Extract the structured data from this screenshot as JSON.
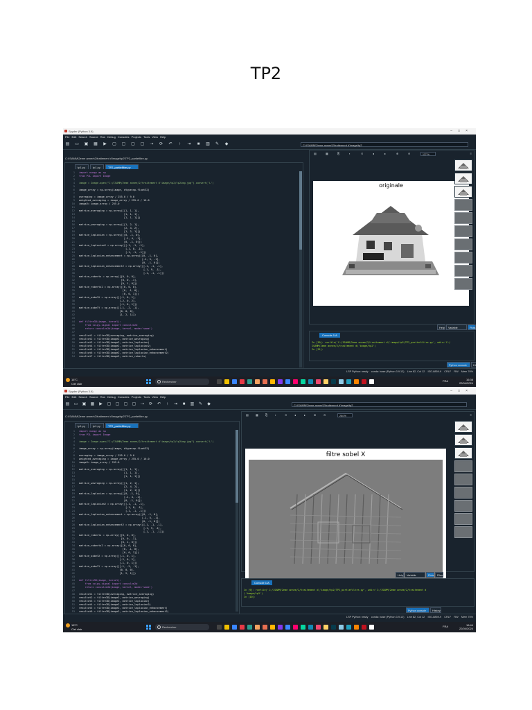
{
  "document": {
    "title": "TP2"
  },
  "screenshots": [
    {
      "window_title": "Spyder (Python 3.9)",
      "menu": [
        "File",
        "Edit",
        "Search",
        "Source",
        "Run",
        "Debug",
        "Consoles",
        "Projects",
        "Tools",
        "View",
        "Help"
      ],
      "path_box": "C:\\ISAMM\\2eme annee\\2\\traitement d'image\\tp2",
      "file_path": "C:\\ISAMM\\2eme annee\\2\\traitement d'image\\tp2\\TP2_partiefiltre.py",
      "editor_tabs": [
        "tp1.py",
        "tp1.py",
        "TP2_partiefiltre.py"
      ],
      "active_tab": 2,
      "zoom": "137 %",
      "plot_title": "originale",
      "plot_kind": "house",
      "right_tabs": [
        "Help",
        "Variable Explorer",
        "Plots",
        "Files"
      ],
      "active_right_tab": 2,
      "console_tab": "Console 1/A",
      "console_lines": [
        "In [30]: runfile('C:/ISAMM/2eme annee/2/traitement d\\'image/tp2/TP2_partiefiltre.py', wdir='C:/",
        "ISAMM/2eme annee/2/traitement d\\'image/tp2')",
        "",
        "In [31]:"
      ],
      "console_bottom_tabs": [
        "Python console",
        "History"
      ],
      "status": "LSP Python: ready    conda: base (Python 3.9.12)    Line 82, Col 12    ISO-8859-9    CRLF    RW    Mem 76%",
      "taskbar": {
        "weather_temp": "16°C",
        "weather_desc": "Ciel clair",
        "search": "Rechercher",
        "lang": "FRA",
        "time": "16:36",
        "date": "22/04/2024"
      }
    },
    {
      "window_title": "Spyder (Python 3.9)",
      "menu": [
        "File",
        "Edit",
        "Search",
        "Source",
        "Run",
        "Debug",
        "Consoles",
        "Projects",
        "Tools",
        "View",
        "Help"
      ],
      "path_box": "C:\\ISAMM\\2eme annee\\2\\traitement d'image\\tp2",
      "file_path": "C:\\ISAMM\\2eme annee\\2\\traitement d'image\\tp2\\TP2_partiefiltre.py",
      "editor_tabs": [
        "tp1.py",
        "tp1.py",
        "TP2_partiefiltre.py"
      ],
      "active_tab": 2,
      "zoom": "264 %",
      "plot_title": "filtre sobel X",
      "plot_kind": "sobel",
      "right_tabs": [
        "Help",
        "Variable Explorer",
        "Plots",
        "Files"
      ],
      "active_right_tab": 2,
      "console_tab": "Console 1/A",
      "console_lines": [
        "In [9]: runfile('C:/ISAMM/2eme annee/2/traitement d\\'image/tp2/TP2_partiefiltre.py', wdir='C:/ISAMM/2eme annee/2/traitement d",
        "\\'image/tp2')",
        "",
        "In [10]:"
      ],
      "console_bottom_tabs": [
        "Python console",
        "History"
      ],
      "status": "LSP Python: ready    conda: base (Python 3.9.12)    Line 82, Col 12    ISO-8859-9    CRLF    RW    Mem 75%",
      "taskbar": {
        "weather_temp": "18°C",
        "weather_desc": "Ciel clair",
        "search": "Rechercher",
        "lang": "FRA",
        "time": "16:44",
        "date": "22/04/2024"
      }
    }
  ],
  "code": [
    "import numpy as np",
    "from PIL import Image",
    "",
    "image = Image.open(\"C:/ISAMM/2eme annee/2/traitement d'image/tp2/tp2img.jpg\").convert('L')",
    "",
    "image_array = np.array(image, dtype=np.float32)",
    "",
    "averaging = image_array / 255.0 / 9.0",
    "weighted_averaging = image_array / 255.0 / 16.0",
    "image2= image_array / 255.0",
    "",
    "matrice_averaging = np.array([[1, 1, 1],",
    "                              [1, 1, 1],",
    "                              [1, 1, 1]])",
    "",
    "matrice_wavraging = np.array([[1, 2, 1],",
    "                              [2, 4, 2],",
    "                              [1, 2, 1]])",
    "matrice_laplacian = np.array([[0, -1, 0],",
    "                              [-1, 4, -1],",
    "                              [0, -1, 0]])",
    "matrice_laplacian2 = np.array([[-1, -1, -1],",
    "                               [-1, 8, -1],",
    "                               [-1, -1, -1]])",
    "matrice_laplacian_enhancement = np.array([[0, -1, 0],",
    "                                          [-1, 5, -1],",
    "                                          [0, -1, 0]])",
    "matrice_laplacian_enhancement2 = np.array([[-1, -1, -1],",
    "                                           [-1, 9, -1],",
    "                                           [-1, -1, -1]])",
    "matrice_roberts = np.array([[0, 0, 0],",
    "                            [0, 0, -1],",
    "                            [0, 1, 0]])",
    "matrice_roberts2 = np.array([[0, 0, 0],",
    "                             [0, -1, 0],",
    "                             [0, 0, 1]])",
    "matrice_sobelX = np.array([[-1, 0, 1],",
    "                           [-2, 0, 2],",
    "                           [-1, 0, 1]])",
    "matrice_sobelY = np.array([[-1, -2, -1],",
    "                           [0, 0, 0],",
    "                           [1, 2, 1]])",
    "",
    "def filtre3D(image, kernel):",
    "    from scipy.signal import convolve2d",
    "    return convolve2d(image, kernel, mode='same')",
    "",
    "resultat1 = filtre3D(averaging, matrice_averaging)",
    "resultat2 = filtre3D(image2, matrice_wavraging)",
    "resultat3 = filtre3D(image2, matrice_laplacian)",
    "resultat4 = filtre3D(image2, matrice_laplacian2)",
    "resultat5 = filtre3D(image2, matrice_laplacian_enhancement)",
    "resultat6 = filtre3D(image2, matrice_laplacian_enhancement2)",
    "resultat7 = filtre3D(image2, matrice_roberts)"
  ],
  "colors": {
    "spyder_bg": "#19232d",
    "accent": "#1a72bb",
    "border": "#32414b"
  }
}
